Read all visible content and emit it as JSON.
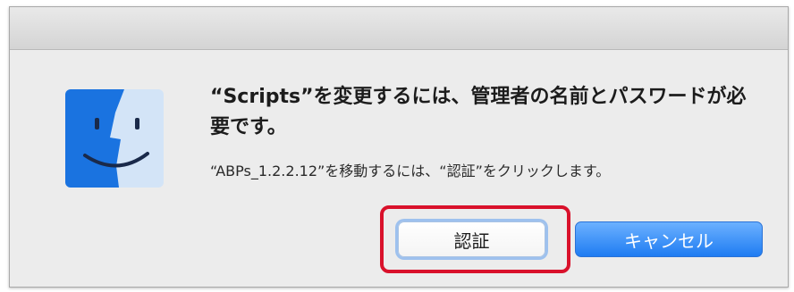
{
  "dialog": {
    "title": "“Scripts”を変更するには、管理者の名前とパスワードが必要です。",
    "message": "“ABPs_1.2.2.12”を移動するには、“認証”をクリックします。",
    "buttons": {
      "authenticate": "認証",
      "cancel": "キャンセル"
    }
  },
  "icons": {
    "app": "finder-icon"
  },
  "colors": {
    "highlight": "#d9112b",
    "primary_button": "#1f7cf2",
    "finder_blue": "#1a73e0",
    "finder_light": "#d3e4f7"
  }
}
